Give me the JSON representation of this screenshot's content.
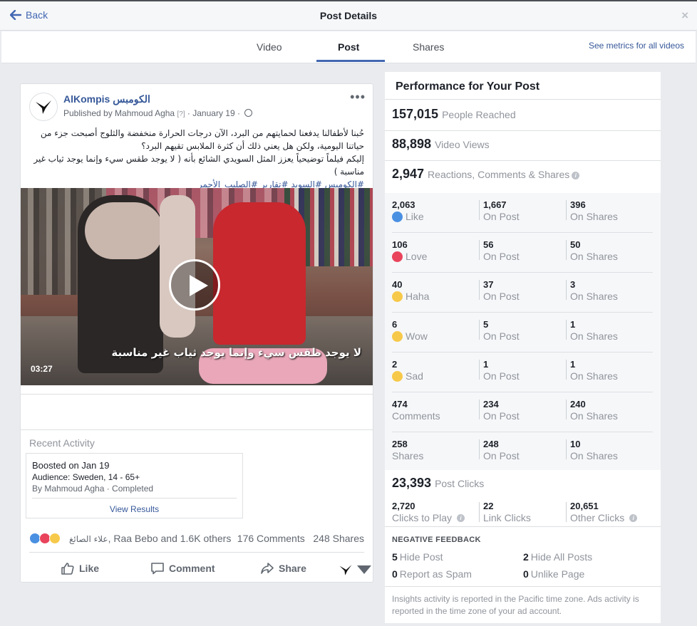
{
  "header": {
    "back_label": "Back",
    "title": "Post Details",
    "close_label": "×"
  },
  "tabs": [
    {
      "label": "Video",
      "active": false
    },
    {
      "label": "Post",
      "active": true
    },
    {
      "label": "Shares",
      "active": false
    }
  ],
  "metrics_link": "See metrics for all videos",
  "post": {
    "page_name": "AlKompis الكومبس",
    "published_by": "Published by Mahmoud Agha",
    "help_mark": "[?]",
    "date": "January 19",
    "menu_icon": "more-dots-icon",
    "text_line1": "حُبنا لأطفالنا يدفعنا لحمايتهم من البرد، الآن درجات الحرارة منخفضة والثلوج أصبحت جزء من حياتنا اليومية، ولكن هل يعني ذلك أن كثرة الملابس تقيهم البرد؟",
    "text_line2": "إليكم فيلماً توضيحياً يعزز المثل السويدي الشائع بأنه ( لا يوجد طقس سيء وإنما يوجد ثياب غير مناسبة )",
    "hashtags": "#الكومبس #السويد #تقارير #الصليب_الأحمر",
    "video_caption": "لا يوجد طقس سيء وإنما يوجد ثياب غير مناسبة",
    "video_duration": "03:27"
  },
  "recent_activity": {
    "title": "Recent Activity",
    "boost_title": "Boosted on Jan 19",
    "audience": "Audience: Sweden, 14 - 65+",
    "by": "By Mahmoud Agha · Completed",
    "view_results": "View Results"
  },
  "reactions_bar": {
    "names_ar": "علاء الصائغ",
    "names_rest": ", Raa Bebo and 1.6K others",
    "comments": "176 Comments",
    "shares": "248 Shares"
  },
  "actions": {
    "like": "Like",
    "comment": "Comment",
    "share": "Share"
  },
  "performance": {
    "title": "Performance for Your Post",
    "reached_num": "157,015",
    "reached_lbl": "People Reached",
    "views_num": "88,898",
    "views_lbl": "Video Views",
    "rcs_num": "2,947",
    "rcs_lbl": "Reactions, Comments & Shares",
    "rows": [
      {
        "total": "2,063",
        "label": "Like",
        "icon": "like-icon",
        "on_post": "1,667",
        "on_shares": "396"
      },
      {
        "total": "106",
        "label": "Love",
        "icon": "love-icon",
        "on_post": "56",
        "on_shares": "50"
      },
      {
        "total": "40",
        "label": "Haha",
        "icon": "haha-icon",
        "on_post": "37",
        "on_shares": "3"
      },
      {
        "total": "6",
        "label": "Wow",
        "icon": "wow-icon",
        "on_post": "5",
        "on_shares": "1"
      },
      {
        "total": "2",
        "label": "Sad",
        "icon": "sad-icon",
        "on_post": "1",
        "on_shares": "1"
      },
      {
        "total": "474",
        "label": "Comments",
        "icon": "",
        "on_post": "234",
        "on_shares": "240"
      },
      {
        "total": "258",
        "label": "Shares",
        "icon": "",
        "on_post": "248",
        "on_shares": "10"
      }
    ],
    "on_post_lbl": "On Post",
    "on_shares_lbl": "On Shares",
    "clicks_num": "23,393",
    "clicks_lbl": "Post Clicks",
    "clicks_play_num": "2,720",
    "clicks_play_lbl": "Clicks to Play",
    "link_clicks_num": "22",
    "link_clicks_lbl": "Link Clicks",
    "other_clicks_num": "20,651",
    "other_clicks_lbl": "Other Clicks",
    "neg_title": "NEGATIVE FEEDBACK",
    "hide_post_num": "5",
    "hide_post_lbl": "Hide Post",
    "hide_all_num": "2",
    "hide_all_lbl": "Hide All Posts",
    "spam_num": "0",
    "spam_lbl": "Report as Spam",
    "unlike_num": "0",
    "unlike_lbl": "Unlike Page",
    "footnote": "Insights activity is reported in the Pacific time zone. Ads activity is reported in the time zone of your ad account."
  },
  "colors": {
    "brand_blue": "#4267b2",
    "link_blue": "#365899",
    "background": "#e9ebee"
  }
}
